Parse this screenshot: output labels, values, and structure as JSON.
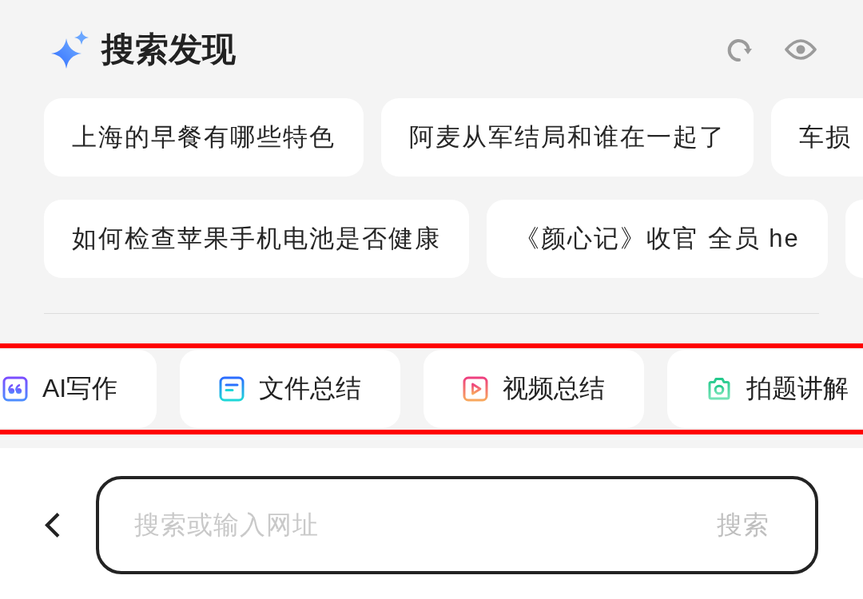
{
  "header": {
    "title": "搜索发现"
  },
  "suggestions": [
    {
      "chips": [
        {
          "kind": "query",
          "label": "上海的早餐有哪些特色"
        },
        {
          "kind": "query",
          "label": "阿麦从军结局和谁在一起了"
        },
        {
          "kind": "query",
          "label": "车损"
        }
      ]
    },
    {
      "chips": [
        {
          "kind": "query",
          "label": "如何检查苹果手机电池是否健康"
        },
        {
          "kind": "query",
          "label": "《颜心记》收官 全员 he"
        },
        {
          "kind": "stub"
        }
      ]
    }
  ],
  "tools": {
    "highlighted": true,
    "items": [
      {
        "label": "AI写作",
        "kind": "quote"
      },
      {
        "label": "文件总结",
        "kind": "document"
      },
      {
        "label": "视频总结",
        "kind": "video"
      },
      {
        "label": "拍题讲解",
        "kind": "camera"
      }
    ]
  },
  "search_bar": {
    "placeholder": "搜索或输入网址",
    "button": "搜索"
  }
}
